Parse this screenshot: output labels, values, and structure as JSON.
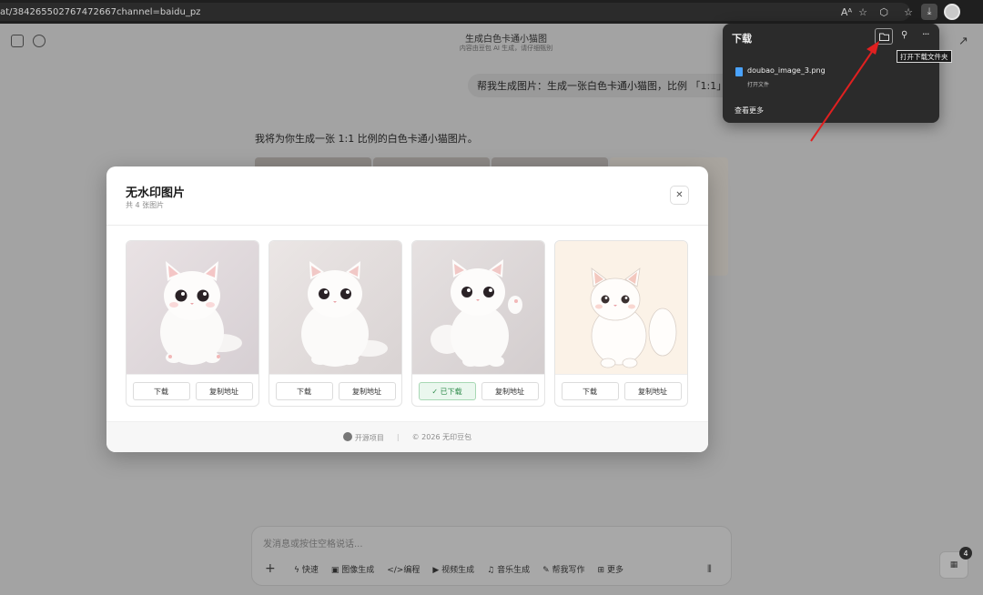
{
  "browser": {
    "url": "at/384265502767472667channel=baidu_pz",
    "toolbar_icons": [
      "reader-mode-icon",
      "favorites-star-icon",
      "extensions-icon",
      "favorites-list-icon",
      "download-icon",
      "profile-avatar"
    ]
  },
  "conversation": {
    "title": "生成白色卡通小猫图",
    "subtitle": "内容由豆包 AI 生成，请仔细甄别",
    "user_message": "帮我生成图片：生成一张白色卡通小猫图，比例 「1:1」",
    "bot_message": "我将为你生成一张 1:1 比例的白色卡通小猫图片。"
  },
  "composer": {
    "placeholder": "发消息或按住空格说话...",
    "tools": [
      {
        "icon": "lightning-icon",
        "label": "快速"
      },
      {
        "icon": "image-icon",
        "label": "图像生成"
      },
      {
        "icon": "code-icon",
        "label": "编程"
      },
      {
        "icon": "video-icon",
        "label": "视频生成"
      },
      {
        "icon": "music-icon",
        "label": "音乐生成"
      },
      {
        "icon": "writing-icon",
        "label": "帮我写作"
      },
      {
        "icon": "grid-icon",
        "label": "更多"
      }
    ],
    "badge_count": "4"
  },
  "modal": {
    "title": "无水印图片",
    "subtitle": "共 4 张图片",
    "close_label": "✕",
    "cards": [
      {
        "download_label": "下载",
        "copy_label": "复制地址",
        "downloaded": false
      },
      {
        "download_label": "下载",
        "copy_label": "复制地址",
        "downloaded": false
      },
      {
        "download_label": "✓ 已下载",
        "copy_label": "复制地址",
        "downloaded": true
      },
      {
        "download_label": "下载",
        "copy_label": "复制地址",
        "downloaded": false
      }
    ],
    "footer": {
      "open_source": "开源项目",
      "copyright": "© 2026 无印豆包"
    }
  },
  "downloads_panel": {
    "title": "下载",
    "file_name": "doubao_image_3.png",
    "file_action": "打开文件",
    "see_more": "查看更多",
    "tooltip": "打开下载文件夹"
  },
  "colors": {
    "accent_green": "#2e8b4a",
    "arrow_red": "#e02020",
    "panel_bg": "#2b2b2b"
  }
}
